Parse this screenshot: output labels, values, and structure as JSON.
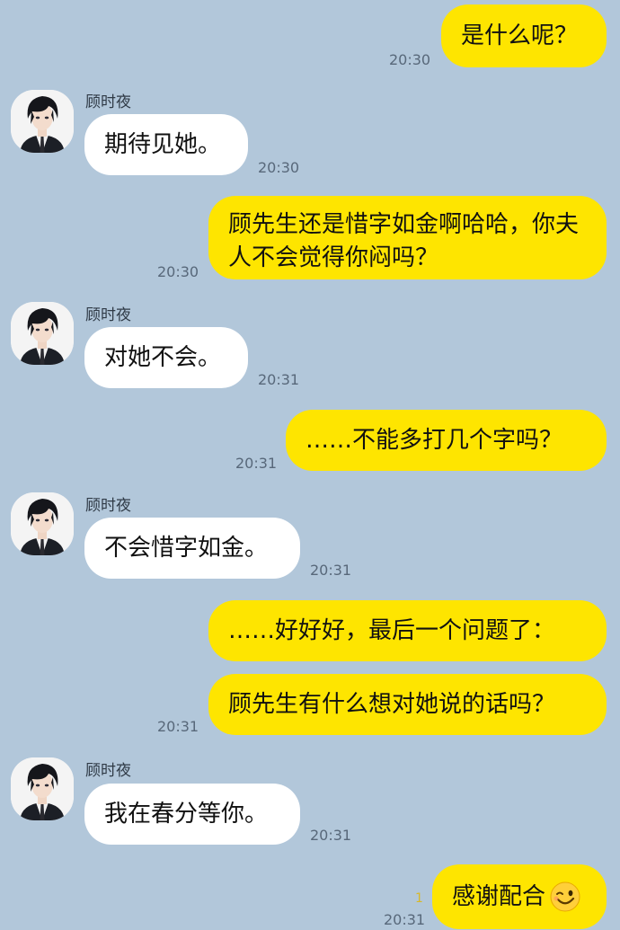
{
  "theme": {
    "background": "#b2c7da",
    "mine_bubble": "#fee500",
    "theirs_bubble": "#ffffff"
  },
  "contact": {
    "name": "顾时夜",
    "avatar_icon": "male-character-avatar"
  },
  "messages": [
    {
      "from": "me",
      "text": "是什么呢？",
      "time": "20:30"
    },
    {
      "from": "them",
      "text": "期待见她。",
      "time": "20:30"
    },
    {
      "from": "me",
      "text": "顾先生还是惜字如金啊哈哈，你夫人不会觉得你闷吗？",
      "time": "20:30"
    },
    {
      "from": "them",
      "text": "对她不会。",
      "time": "20:31"
    },
    {
      "from": "me",
      "text": "……不能多打几个字吗？",
      "time": "20:31"
    },
    {
      "from": "them",
      "text": "不会惜字如金。",
      "time": "20:31"
    },
    {
      "from": "me",
      "text": "……好好好，最后一个问题了：",
      "time": ""
    },
    {
      "from": "me",
      "text": "顾先生有什么想对她说的话吗？",
      "time": "20:31"
    },
    {
      "from": "them",
      "text": "我在春分等你。",
      "time": "20:31"
    },
    {
      "from": "me",
      "text": "感谢配合",
      "emoji": "winking-face-emoji",
      "time": "20:31",
      "unread": "1"
    }
  ]
}
